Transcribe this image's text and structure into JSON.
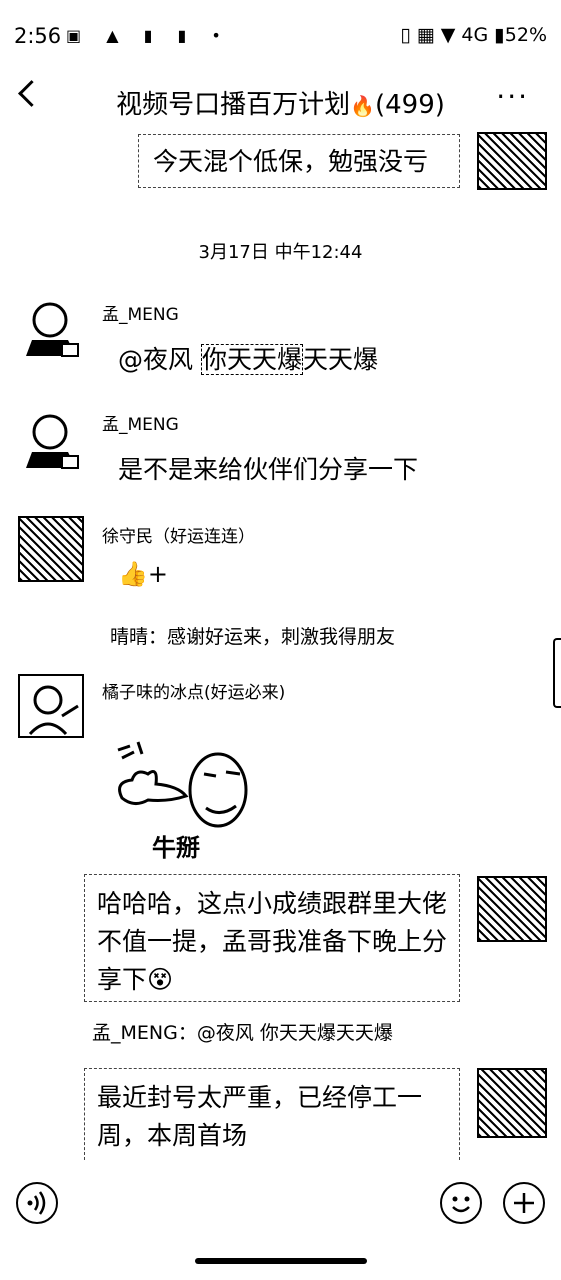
{
  "status": {
    "time": "2:56",
    "left_icons": "▣ ▲ ▮ ▮ •",
    "right_icons": "▯ ▦ ▼ 4G",
    "battery": "52%"
  },
  "header": {
    "title": "视频号口播百万计划",
    "fire": "🔥",
    "count": "(499)",
    "more": "···"
  },
  "messages": {
    "m0": {
      "text": "今天混个低保，勉强没亏"
    },
    "timestamp": "3月17日 中午12:44",
    "m1": {
      "sender": "孟_MENG",
      "mention": "@夜风 ",
      "highlight": "你天天爆",
      "rest": "天天爆"
    },
    "m2": {
      "sender": "孟_MENG",
      "text": "是不是来给伙伴们分享一下"
    },
    "m3": {
      "sender": "徐守民（好运连连）",
      "reaction": "👍+",
      "quote": "晴晴：感谢好运来，刺激我得朋友"
    },
    "m4": {
      "sender": "橘子味的冰点(好运必来)",
      "sticker_caption": "牛掰"
    },
    "m5": {
      "text": "哈哈哈，这点小成绩跟群里大佬不值一提，孟哥我准备下晚上分享下😵",
      "quote": "孟_MENG：@夜风 你天天爆天天爆"
    },
    "m6": {
      "text": "最近封号太严重，已经停工一周，本周首场"
    }
  },
  "input": {
    "voice_icon": "voice-icon",
    "emoji_icon": "emoji-icon",
    "plus_icon": "plus-icon"
  }
}
